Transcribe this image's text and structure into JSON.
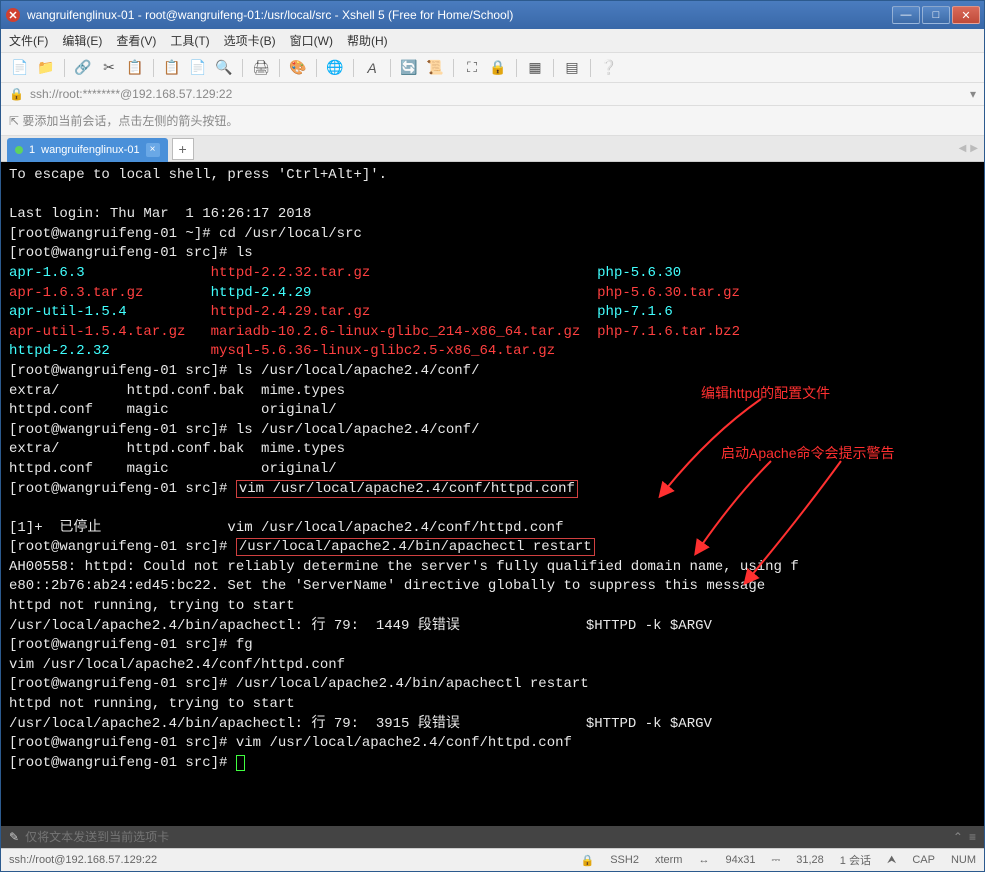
{
  "window": {
    "title": "wangruifenglinux-01 - root@wangruifeng-01:/usr/local/src - Xshell 5 (Free for Home/School)"
  },
  "menu": {
    "file": "文件(F)",
    "edit": "编辑(E)",
    "view": "查看(V)",
    "tools": "工具(T)",
    "tab": "选项卡(B)",
    "window": "窗口(W)",
    "help": "帮助(H)"
  },
  "address": {
    "value": "ssh://root:********@192.168.57.129:22"
  },
  "hint": {
    "text": "要添加当前会话，点击左侧的箭头按钮。"
  },
  "tabs": {
    "active": {
      "index": "1",
      "label": "wangruifenglinux-01"
    }
  },
  "terminal": {
    "escape": "To escape to local shell, press 'Ctrl+Alt+]'.",
    "lastlogin": "Last login: Thu Mar  1 16:26:17 2018",
    "prompt_home": "[root@wangruifeng-01 ~]# ",
    "cmd_cd": "cd /usr/local/src",
    "prompt_src": "[root@wangruifeng-01 src]# ",
    "cmd_ls": "ls",
    "ls_col1": [
      "apr-1.6.3",
      "apr-1.6.3.tar.gz",
      "apr-util-1.5.4",
      "apr-util-1.5.4.tar.gz",
      "httpd-2.2.32"
    ],
    "ls_col2": [
      "httpd-2.2.32.tar.gz",
      "httpd-2.4.29",
      "httpd-2.4.29.tar.gz",
      "mariadb-10.2.6-linux-glibc_214-x86_64.tar.gz",
      "mysql-5.6.36-linux-glibc2.5-x86_64.tar.gz"
    ],
    "ls_col3": [
      "php-5.6.30",
      "php-5.6.30.tar.gz",
      "php-7.1.6",
      "php-7.1.6.tar.bz2"
    ],
    "cmd_ls2": "ls /usr/local/apache2.4/conf/",
    "ls2_l1": "extra/        httpd.conf.bak  mime.types",
    "ls2_l2": "httpd.conf    magic           original/",
    "cmd_vim": "vim /usr/local/apache2.4/conf/httpd.conf",
    "stopped": "[1]+  已停止               vim /usr/local/apache2.4/conf/httpd.conf",
    "cmd_restart": "/usr/local/apache2.4/bin/apachectl restart",
    "warn1": "AH00558: httpd: Could not reliably determine the server's fully qualified domain name, using f",
    "warn2": "e80::2b76:ab24:ed45:bc22. Set the 'ServerName' directive globally to suppress this message",
    "notrunning": "httpd not running, trying to start",
    "segfault1": "/usr/local/apache2.4/bin/apachectl: 行 79:  1449 段错误               $HTTPD -k $ARGV",
    "cmd_fg": "fg",
    "fg_out": "vim /usr/local/apache2.4/conf/httpd.conf",
    "segfault2": "/usr/local/apache2.4/bin/apachectl: 行 79:  3915 段错误               $HTTPD -k $ARGV",
    "annot1": "编辑httpd的配置文件",
    "annot2": "启动Apache命令会提示警告"
  },
  "inputbar": {
    "placeholder": "仅将文本发送到当前选项卡"
  },
  "status": {
    "conn": "ssh://root@192.168.57.129:22",
    "ssh": "SSH2",
    "term": "xterm",
    "size": "94x31",
    "pos": "31,28",
    "sessions": "1 会话",
    "cap": "CAP",
    "num": "NUM"
  }
}
